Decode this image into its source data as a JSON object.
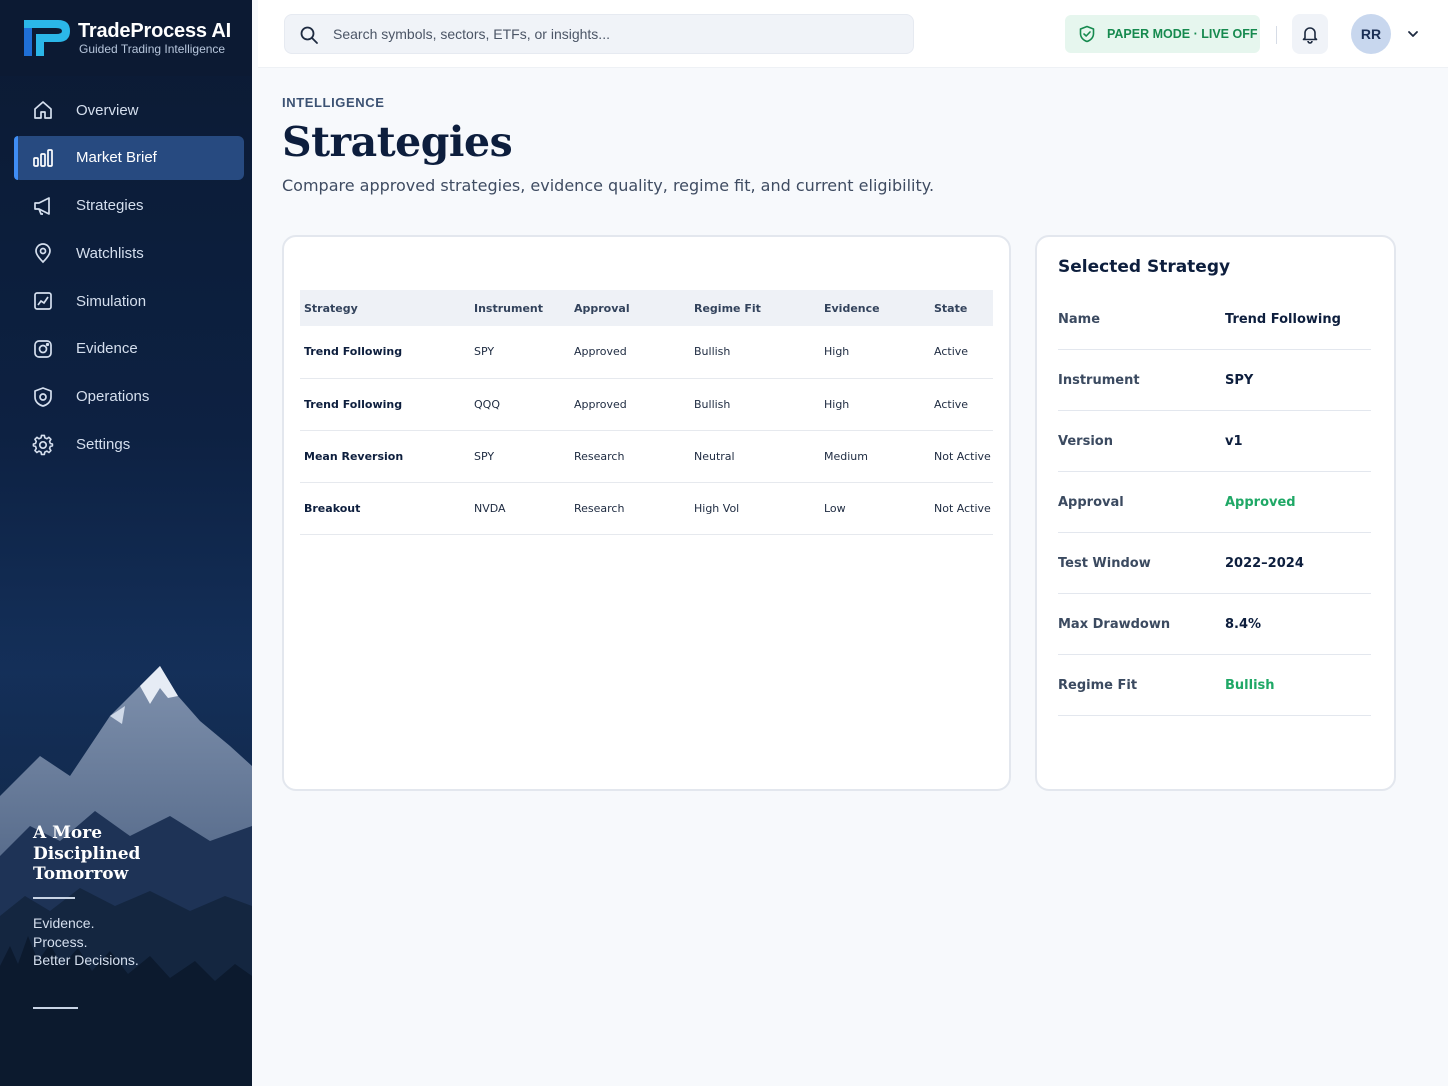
{
  "brand": {
    "name": "TradeProcess AI",
    "tagline": "Guided Trading Intelligence"
  },
  "sidebar": {
    "items": [
      {
        "label": "Overview",
        "icon": "home-icon",
        "active": false
      },
      {
        "label": "Market Brief",
        "icon": "bar-chart-icon",
        "active": true
      },
      {
        "label": "Strategies",
        "icon": "megaphone-icon",
        "active": false
      },
      {
        "label": "Watchlists",
        "icon": "location-pin-icon",
        "active": false
      },
      {
        "label": "Simulation",
        "icon": "chart-frame-icon",
        "active": false
      },
      {
        "label": "Evidence",
        "icon": "camera-icon",
        "active": false
      },
      {
        "label": "Operations",
        "icon": "shield-gear-icon",
        "active": false
      },
      {
        "label": "Settings",
        "icon": "gear-icon",
        "active": false
      }
    ],
    "quote": [
      "A More",
      "Disciplined",
      "Tomorrow"
    ],
    "motto": [
      "Evidence.",
      "Process.",
      "Better Decisions."
    ]
  },
  "topbar": {
    "search_placeholder": "Search symbols, sectors, ETFs, or insights...",
    "mode_badge": "PAPER MODE · LIVE OFF",
    "avatar_initials": "RR"
  },
  "page": {
    "eyebrow": "INTELLIGENCE",
    "title": "Strategies",
    "subtitle": "Compare approved strategies, evidence quality, regime fit, and current eligibility."
  },
  "table": {
    "columns": [
      "Strategy",
      "Instrument",
      "Approval",
      "Regime Fit",
      "Evidence",
      "State"
    ],
    "rows": [
      [
        "Trend Following",
        "SPY",
        "Approved",
        "Bullish",
        "High",
        "Active"
      ],
      [
        "Trend Following",
        "QQQ",
        "Approved",
        "Bullish",
        "High",
        "Active"
      ],
      [
        "Mean Reversion",
        "SPY",
        "Research",
        "Neutral",
        "Medium",
        "Not Active"
      ],
      [
        "Breakout",
        "NVDA",
        "Research",
        "High Vol",
        "Low",
        "Not Active"
      ]
    ]
  },
  "detail": {
    "title": "Selected Strategy",
    "fields": [
      {
        "label": "Name",
        "value": "Trend Following",
        "highlight": false
      },
      {
        "label": "Instrument",
        "value": "SPY",
        "highlight": false
      },
      {
        "label": "Version",
        "value": "v1",
        "highlight": false
      },
      {
        "label": "Approval",
        "value": "Approved",
        "highlight": true
      },
      {
        "label": "Test Window",
        "value": "2022–2024",
        "highlight": false
      },
      {
        "label": "Max Drawdown",
        "value": "8.4%",
        "highlight": false
      },
      {
        "label": "Regime Fit",
        "value": "Bullish",
        "highlight": true
      }
    ]
  },
  "colors": {
    "sidebar_bg": "#0d2142",
    "active_nav": "#274a80",
    "accent": "#3f8df5",
    "positive": "#1fa866",
    "badge_bg": "#e6f6ee"
  }
}
